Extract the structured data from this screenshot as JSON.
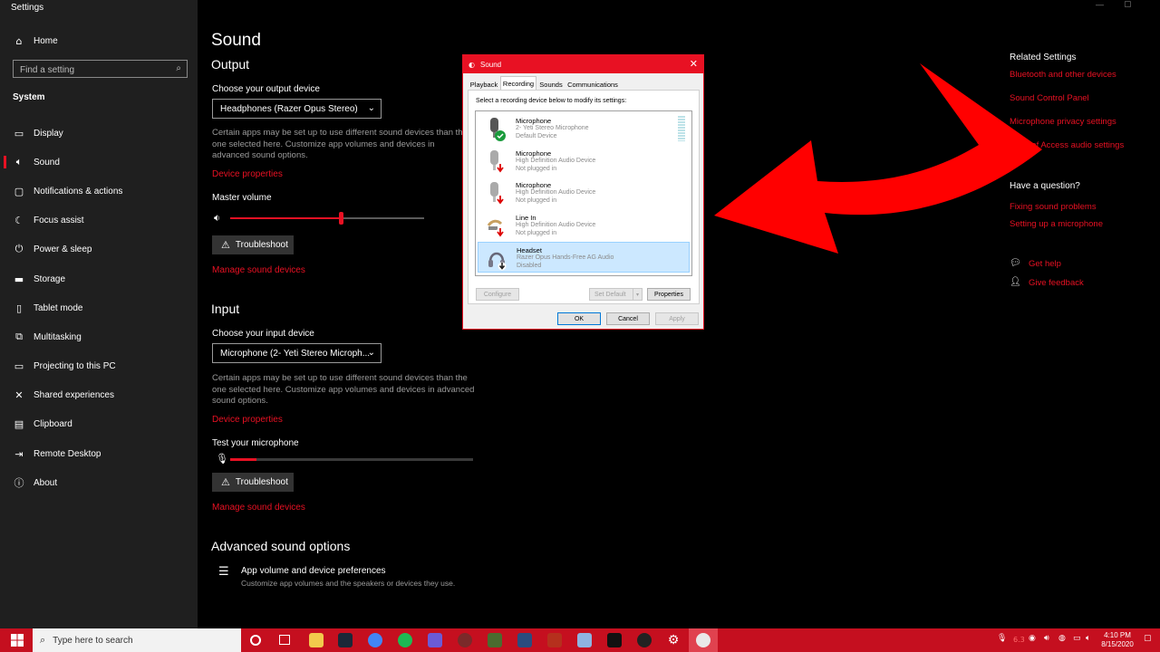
{
  "window": {
    "title": "Settings",
    "controls": {
      "minimize": "—",
      "maximize": "▢"
    }
  },
  "sidebar": {
    "home": "Home",
    "search_placeholder": "Find a setting",
    "section": "System",
    "items": [
      {
        "label": "Display",
        "icon": "display-icon"
      },
      {
        "label": "Sound",
        "icon": "speaker-icon",
        "active": true
      },
      {
        "label": "Notifications & actions",
        "icon": "notifications-icon"
      },
      {
        "label": "Focus assist",
        "icon": "moon-icon"
      },
      {
        "label": "Power & sleep",
        "icon": "power-icon"
      },
      {
        "label": "Storage",
        "icon": "storage-icon"
      },
      {
        "label": "Tablet mode",
        "icon": "tablet-icon"
      },
      {
        "label": "Multitasking",
        "icon": "multitasking-icon"
      },
      {
        "label": "Projecting to this PC",
        "icon": "project-icon"
      },
      {
        "label": "Shared experiences",
        "icon": "shared-icon"
      },
      {
        "label": "Clipboard",
        "icon": "clipboard-icon"
      },
      {
        "label": "Remote Desktop",
        "icon": "remote-icon"
      },
      {
        "label": "About",
        "icon": "info-icon"
      }
    ]
  },
  "main": {
    "title": "Sound",
    "output": {
      "heading": "Output",
      "choose_label": "Choose your output device",
      "device": "Headphones (Razer Opus Stereo)",
      "desc": "Certain apps may be set up to use different sound devices than the one selected here. Customize app volumes and devices in advanced sound options.",
      "device_properties": "Device properties",
      "master_volume_label": "Master volume",
      "master_volume_fraction": 0.57,
      "troubleshoot": "Troubleshoot",
      "manage": "Manage sound devices"
    },
    "input": {
      "heading": "Input",
      "choose_label": "Choose your input device",
      "device": "Microphone (2- Yeti Stereo Microph...",
      "desc": "Certain apps may be set up to use different sound devices than the one selected here. Customize app volumes and devices in advanced sound options.",
      "device_properties": "Device properties",
      "test_label": "Test your microphone",
      "mic_level_fraction": 0.11,
      "troubleshoot": "Troubleshoot",
      "manage": "Manage sound devices"
    },
    "advanced": {
      "heading": "Advanced sound options",
      "item_title": "App volume and device preferences",
      "item_desc": "Customize app volumes and the speakers or devices they use."
    }
  },
  "dialog": {
    "title": "Sound",
    "tabs": [
      "Playback",
      "Recording",
      "Sounds",
      "Communications"
    ],
    "active_tab": 1,
    "instruction": "Select a recording device below to modify its settings:",
    "devices": [
      {
        "name": "Microphone",
        "line1": "2- Yeti Stereo Microphone",
        "line2": "Default Device",
        "status": "default"
      },
      {
        "name": "Microphone",
        "line1": "High Definition Audio Device",
        "line2": "Not plugged in",
        "status": "unplugged"
      },
      {
        "name": "Microphone",
        "line1": "High Definition Audio Device",
        "line2": "Not plugged in",
        "status": "unplugged"
      },
      {
        "name": "Line In",
        "line1": "High Definition Audio Device",
        "line2": "Not plugged in",
        "status": "unplugged"
      },
      {
        "name": "Headset",
        "line1": "Razer Opus Hands-Free AG Audio",
        "line2": "Disabled",
        "status": "disabled",
        "selected": true
      }
    ],
    "buttons": {
      "configure": "Configure",
      "set_default": "Set Default",
      "properties": "Properties",
      "ok": "OK",
      "cancel": "Cancel",
      "apply": "Apply"
    }
  },
  "related": {
    "heading": "Related Settings",
    "links": [
      "Bluetooth and other devices",
      "Sound Control Panel",
      "Microphone privacy settings",
      "Ease of Access audio settings"
    ],
    "question_heading": "Have a question?",
    "question_links": [
      "Fixing sound problems",
      "Setting up a microphone"
    ],
    "get_help": "Get help",
    "give_feedback": "Give feedback"
  },
  "taskbar": {
    "search_placeholder": "Type here to search",
    "time": "4:10 PM",
    "date": "8/15/2020",
    "tray_temp": "6.3"
  },
  "colors": {
    "accent": "#e81123",
    "taskbar": "#c50f1f",
    "selection": "#cce8ff"
  }
}
